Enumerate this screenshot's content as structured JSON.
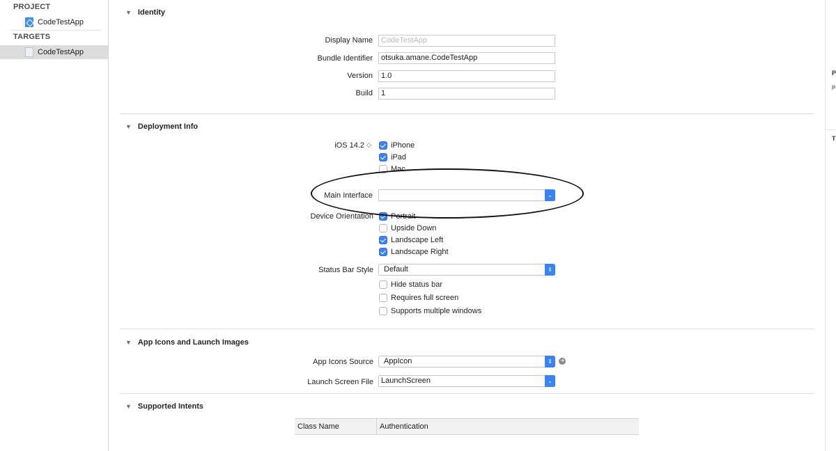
{
  "sidebar": {
    "project_header": "PROJECT",
    "project_item": "CodeTestApp",
    "targets_header": "TARGETS",
    "target_item": "CodeTestApp"
  },
  "inspector": {
    "label_1": "P",
    "label_2": "P",
    "label_3": "T"
  },
  "identity": {
    "title": "Identity",
    "display_name_label": "Display Name",
    "display_name_placeholder": "CodeTestApp",
    "bundle_id_label": "Bundle Identifier",
    "bundle_id_value": "otsuka.amane.CodeTestApp",
    "version_label": "Version",
    "version_value": "1.0",
    "build_label": "Build",
    "build_value": "1"
  },
  "deployment": {
    "title": "Deployment Info",
    "ios_version": "iOS 14.2",
    "devices": [
      {
        "label": "iPhone",
        "checked": true
      },
      {
        "label": "iPad",
        "checked": true
      },
      {
        "label": "Mac",
        "checked": false
      }
    ],
    "main_interface_label": "Main Interface",
    "main_interface_value": "",
    "orientation_label": "Device Orientation",
    "orientations": [
      {
        "label": "Portrait",
        "checked": true
      },
      {
        "label": "Upside Down",
        "checked": false
      },
      {
        "label": "Landscape Left",
        "checked": true
      },
      {
        "label": "Landscape Right",
        "checked": true
      }
    ],
    "status_bar_label": "Status Bar Style",
    "status_bar_value": "Default",
    "options": [
      {
        "label": "Hide status bar",
        "checked": false
      },
      {
        "label": "Requires full screen",
        "checked": false
      },
      {
        "label": "Supports multiple windows",
        "checked": false
      }
    ]
  },
  "app_icons": {
    "title": "App Icons and Launch Images",
    "source_label": "App Icons Source",
    "source_value": "AppIcon",
    "launch_label": "Launch Screen File",
    "launch_value": "LaunchScreen"
  },
  "intents": {
    "title": "Supported Intents",
    "columns": [
      "Class Name",
      "Authentication"
    ]
  }
}
